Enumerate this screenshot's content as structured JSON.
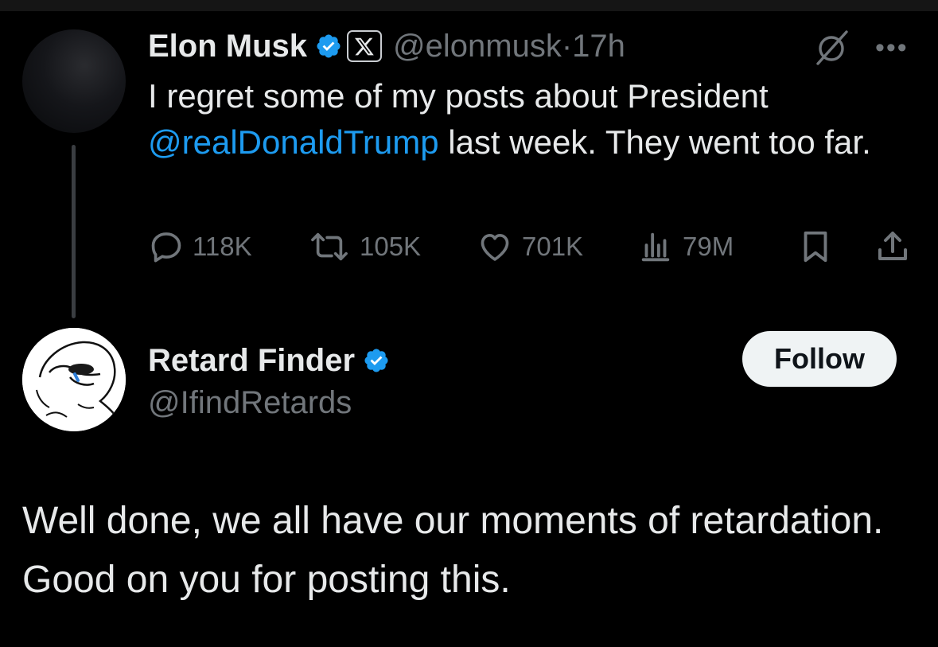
{
  "colors": {
    "background": "#000000",
    "text_primary": "#e7e9ea",
    "text_secondary": "#71767b",
    "link_blue": "#1d9bf0",
    "verified_blue": "#1d9bf0",
    "thread_line": "#3a3d41"
  },
  "parent_tweet": {
    "author_name": "Elon Musk",
    "verified_icon": "verified-badge-icon",
    "affiliate_icon": "x-logo-icon",
    "handle": "@elonmusk",
    "separator": "·",
    "time": "17h",
    "grok_icon": "grok-icon",
    "more_icon": "more-icon",
    "more_glyph": "•••",
    "text_before_mention": "I regret some of my posts about President ",
    "mention": "@realDonaldTrump",
    "text_after_mention": " last week. They went too far.",
    "actions": {
      "reply": {
        "icon": "reply-icon",
        "count": "118K"
      },
      "repost": {
        "icon": "repost-icon",
        "count": "105K"
      },
      "like": {
        "icon": "heart-icon",
        "count": "701K"
      },
      "views": {
        "icon": "views-icon",
        "count": "79M"
      },
      "bookmark": {
        "icon": "bookmark-icon"
      },
      "share": {
        "icon": "share-icon"
      }
    }
  },
  "reply": {
    "author_name": "Retard Finder",
    "verified_icon": "verified-badge-icon",
    "handle": "@IfindRetards",
    "follow_label": "Follow",
    "text": "Well done, we all have our moments of retardation. Good on you for posting this."
  }
}
